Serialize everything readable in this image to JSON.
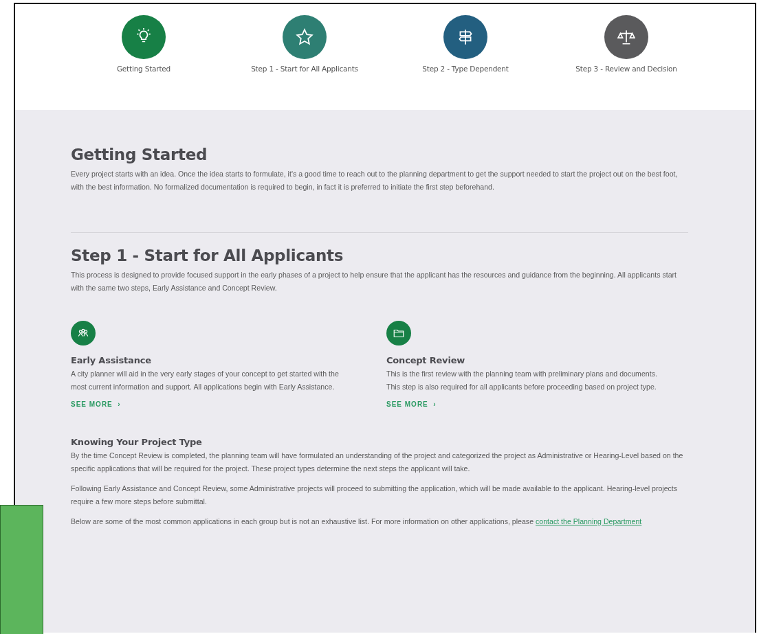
{
  "steps": [
    {
      "label": "Getting Started",
      "color": "#178046",
      "kind": "bulb"
    },
    {
      "label": "Step 1 - Start for All Applicants",
      "color": "#2e7f73",
      "kind": "star"
    },
    {
      "label": "Step 2 - Type Dependent",
      "color": "#235f80",
      "kind": "signpost"
    },
    {
      "label": "Step 3 - Review and Decision",
      "color": "#5a5a5c",
      "kind": "scales"
    }
  ],
  "getting_started": {
    "heading": "Getting Started",
    "text": "Every project starts with an idea. Once the idea starts to formulate, it's a good time to reach out to the planning department to get the support needed to start the project out on the best foot, with the best information. No formalized documentation is required to begin, in fact it is preferred to initiate the first step beforehand."
  },
  "step_1": {
    "heading": "Step 1 - Start for All Applicants",
    "text": "This process is designed to provide focused support in the early phases of a project to help ensure that the applicant has the resources and guidance from the beginning. All applicants start with the same two steps, Early Assistance and Concept Review.",
    "cards": [
      {
        "kind": "people",
        "title": "Early Assistance",
        "text": "A city planner will aid in the very early stages of your concept to get started with the most current information and support. All applications begin with Early Assistance.",
        "link": "SEE MORE",
        "chevron": "›"
      },
      {
        "kind": "folder",
        "title": "Concept Review",
        "text": "This is the first review with the planning team with preliminary plans and documents. This step is also required for all applicants before proceeding based on project type.",
        "link": "SEE MORE",
        "chevron": "›"
      }
    ]
  },
  "project_type": {
    "heading": "Knowing Your Project Type",
    "paragraphs": [
      "By the time Concept Review is completed, the planning team will have formulated an understanding of the project and categorized the project as Administrative or Hearing-Level based on the specific applications that will be required for the project. These project types determine the next steps the applicant will take.",
      "Following Early Assistance and Concept Review, some Administrative projects will proceed to submitting the application, which will be made available to the applicant. Hearing-level projects require a few more steps before submittal."
    ],
    "closing_text": "Below are some of the most common applications in each group but is not an exhaustive list. For more information on other applications, please ",
    "closing_link": "contact the Planning Department"
  }
}
